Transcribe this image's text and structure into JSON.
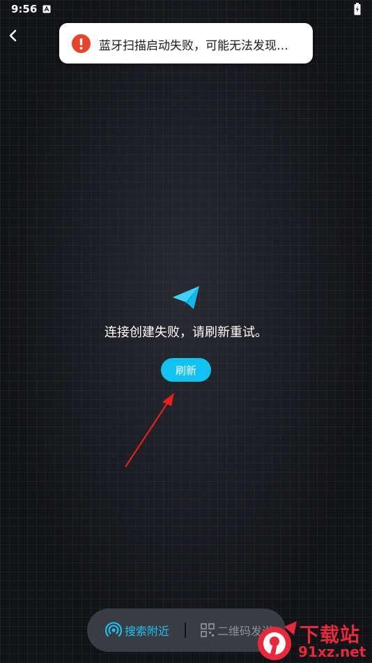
{
  "status_bar": {
    "time": "9:56"
  },
  "toast": {
    "message": "蓝牙扫描启动失败，可能无法发现…",
    "icon": "alert-icon",
    "icon_color": "#e8432b"
  },
  "main": {
    "icon": "paper-plane-icon",
    "error_message": "连接创建失败，请刷新重试。",
    "refresh_label": "刷新",
    "accent_color": "#12c2f1"
  },
  "bottom_bar": {
    "tabs": [
      {
        "label": "搜索附近",
        "icon": "nearby-signal-icon",
        "active": true
      },
      {
        "label": "二维码发送",
        "icon": "qr-code-icon",
        "active": false
      }
    ]
  },
  "watermark": {
    "badge": "9",
    "title": "下载站",
    "site": "91xz.net"
  }
}
